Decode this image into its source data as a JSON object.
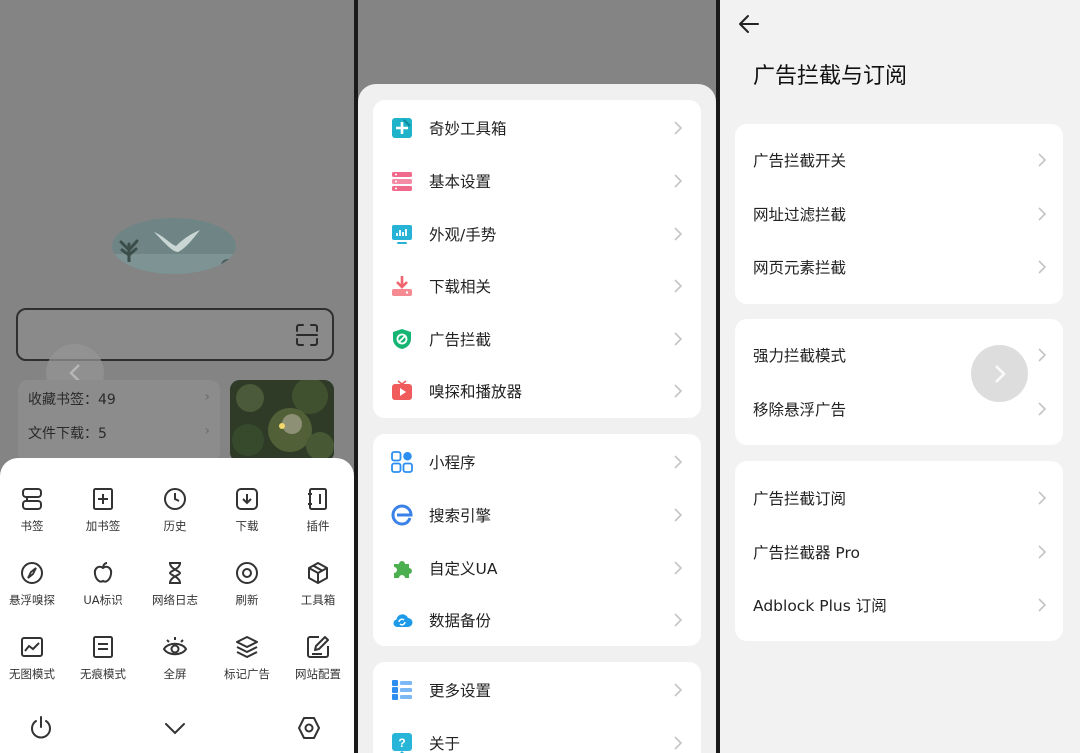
{
  "panel1": {
    "stats": {
      "bookmarks": "收藏书签：49",
      "downloads": "文件下载：5"
    },
    "menu": [
      {
        "label": "书签",
        "icon": "bookmark-list-icon"
      },
      {
        "label": "加书签",
        "icon": "add-bookmark-icon"
      },
      {
        "label": "历史",
        "icon": "history-clock-icon"
      },
      {
        "label": "下载",
        "icon": "download-icon"
      },
      {
        "label": "插件",
        "icon": "plugin-icon"
      },
      {
        "label": "悬浮嗅探",
        "icon": "compass-icon"
      },
      {
        "label": "UA标识",
        "icon": "apple-icon"
      },
      {
        "label": "网络日志",
        "icon": "hourglass-icon"
      },
      {
        "label": "刷新",
        "icon": "refresh-circle-icon"
      },
      {
        "label": "工具箱",
        "icon": "toolbox-cube-icon"
      },
      {
        "label": "无图模式",
        "icon": "no-image-icon"
      },
      {
        "label": "无痕模式",
        "icon": "incognito-icon"
      },
      {
        "label": "全屏",
        "icon": "fullscreen-eye-icon"
      },
      {
        "label": "标记广告",
        "icon": "layers-icon"
      },
      {
        "label": "网站配置",
        "icon": "site-config-icon"
      }
    ],
    "bottom_icons": [
      "power-icon",
      "chevron-down-icon",
      "settings-hexagon-icon"
    ]
  },
  "panel2": {
    "groups": [
      [
        {
          "label": "奇妙工具箱",
          "icon": "toolbox-plus-icon",
          "color": "#1fb3c9"
        },
        {
          "label": "基本设置",
          "icon": "basic-settings-icon",
          "color": "#f06b8b"
        },
        {
          "label": "外观/手势",
          "icon": "appearance-icon",
          "color": "#27b3d6"
        },
        {
          "label": "下载相关",
          "icon": "download-related-icon",
          "color": "#f0646e"
        },
        {
          "label": "广告拦截",
          "icon": "ad-block-shield-icon",
          "color": "#16b574"
        },
        {
          "label": "嗅探和播放器",
          "icon": "sniffer-player-icon",
          "color": "#f05b5b"
        }
      ],
      [
        {
          "label": "小程序",
          "icon": "mini-program-icon",
          "color": "#2c8ef0"
        },
        {
          "label": "搜索引擎",
          "icon": "search-engine-icon",
          "color": "#3b82e8"
        },
        {
          "label": "自定义UA",
          "icon": "puzzle-icon",
          "color": "#4caf50"
        },
        {
          "label": "数据备份",
          "icon": "cloud-backup-icon",
          "color": "#1e9be8"
        }
      ],
      [
        {
          "label": "更多设置",
          "icon": "more-settings-icon",
          "color": "#2e8ef0"
        },
        {
          "label": "关于",
          "icon": "about-help-icon",
          "color": "#28b5d8"
        }
      ]
    ]
  },
  "panel3": {
    "title": "广告拦截与订阅",
    "cards": [
      [
        "广告拦截开关",
        "网址过滤拦截",
        "网页元素拦截"
      ],
      [
        "强力拦截模式",
        "移除悬浮广告"
      ],
      [
        "广告拦截订阅",
        "广告拦截器 Pro",
        "Adblock Plus 订阅"
      ]
    ]
  }
}
